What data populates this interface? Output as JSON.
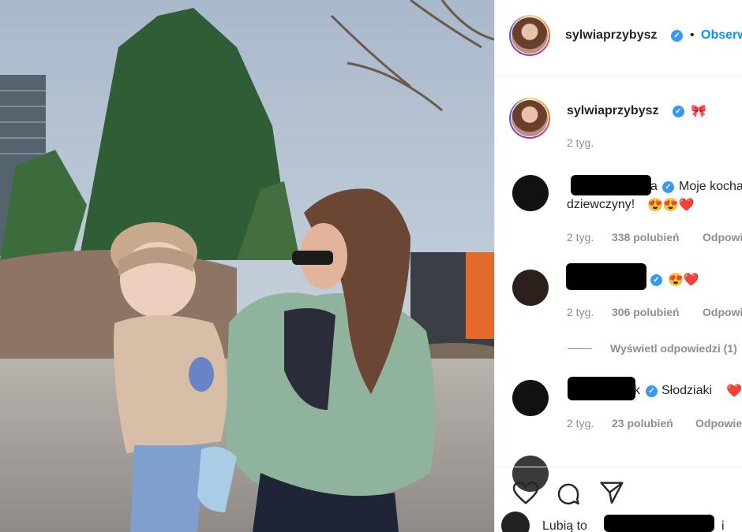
{
  "post": {
    "author": "sylwiaprzybysz",
    "follow_label": "Obserwuj",
    "header_separator": "•",
    "caption_emoji": "🎀",
    "caption_time": "2 tyg."
  },
  "comments": [
    {
      "username_visible_suffix": "a",
      "text": "Moje kochane",
      "text_line2": "dziewczyny!",
      "emoji": "😍😍❤️",
      "time": "2 tyg.",
      "likes": "338 polubień",
      "reply": "Odpowiedz"
    },
    {
      "username_visible_suffix": "",
      "text": "",
      "emoji": "😍❤️",
      "time": "2 tyg.",
      "likes": "306 polubień",
      "reply": "Odpowiedz",
      "view_replies": "Wyświetl odpowiedzi (1)"
    },
    {
      "username_visible_suffix": "k",
      "text": "Słodziaki",
      "emoji": "❤️",
      "time": "2 tyg.",
      "likes": "23 polubień",
      "reply": "Odpowiedz"
    }
  ],
  "footer": {
    "liked_by": "Lubią to",
    "liked_by_suffix": "i"
  },
  "icons": [
    "heart-icon",
    "comment-icon",
    "share-icon",
    "verified-icon"
  ],
  "colors": {
    "link": "#0095f6",
    "verified": "#3897f0",
    "muted": "#8e8e8e",
    "text": "#262626"
  }
}
